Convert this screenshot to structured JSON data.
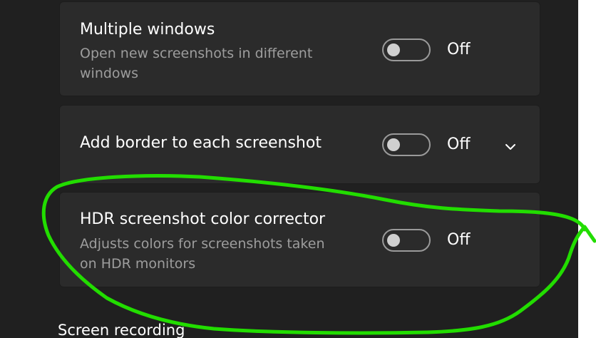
{
  "settings": [
    {
      "title": "Multiple windows",
      "description": "Open new screenshots in different windows",
      "toggle_state": "Off"
    },
    {
      "title": "Add border to each screenshot",
      "toggle_state": "Off"
    },
    {
      "title": "HDR screenshot color corrector",
      "description": "Adjusts colors for screenshots taken on HDR monitors",
      "toggle_state": "Off"
    }
  ],
  "next_section": {
    "heading": "Screen recording"
  },
  "annotation": {
    "color": "#22dd00"
  },
  "theme": {
    "window_bg": "#202020",
    "card_bg": "#2b2b2b",
    "text_primary": "#ffffff",
    "text_secondary": "#9d9d9d"
  },
  "icons": {
    "expand": "chevron-down-icon"
  }
}
